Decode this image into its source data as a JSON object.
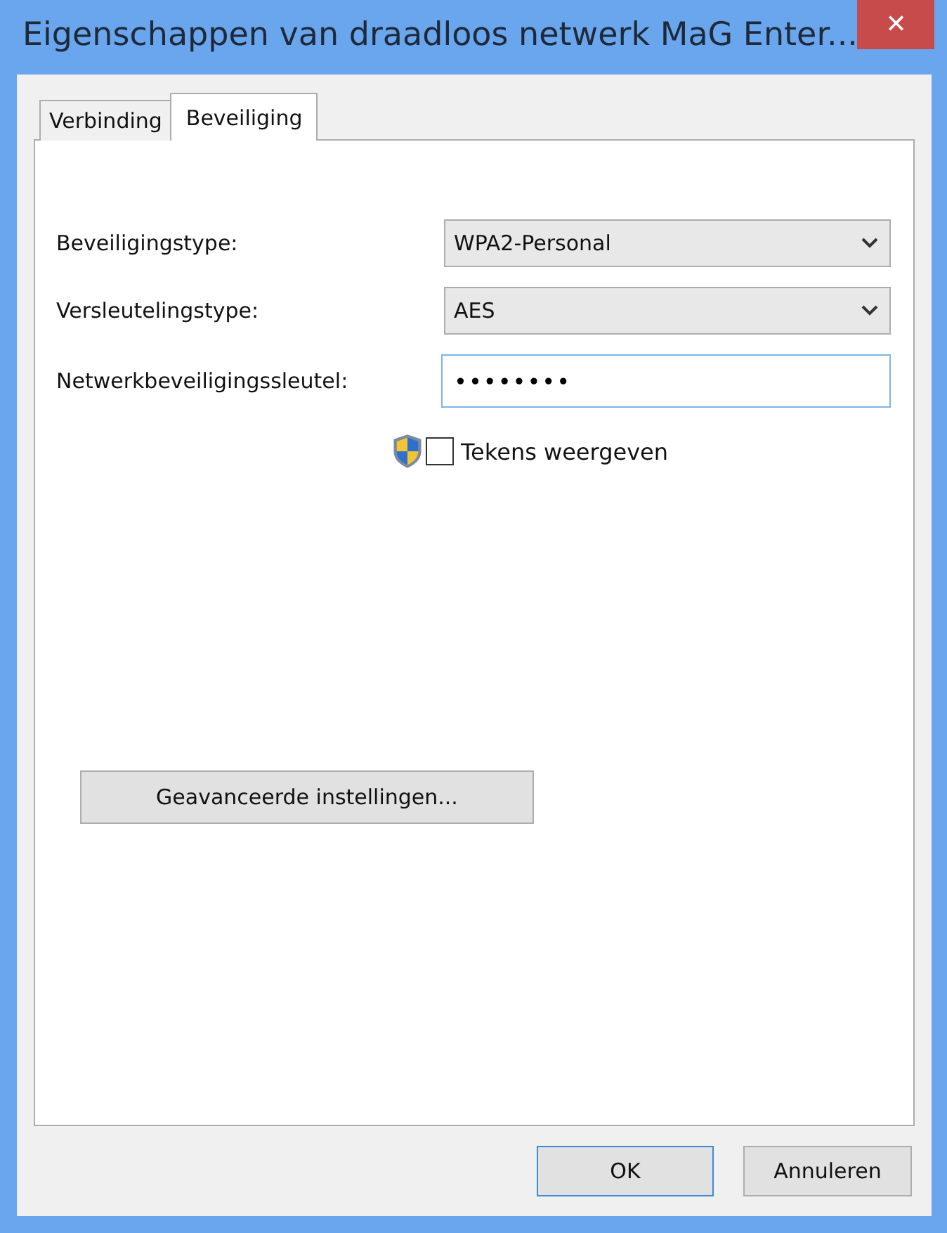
{
  "window": {
    "title": "Eigenschappen van draadloos netwerk MaG Enter...",
    "close": "✕"
  },
  "tabs": [
    {
      "label": "Verbinding",
      "selected": false
    },
    {
      "label": "Beveiliging",
      "selected": true
    }
  ],
  "fields": [
    {
      "kind": "dropdown",
      "label": "Beveiligingstype:",
      "value": "WPA2-Personal"
    },
    {
      "kind": "dropdown",
      "label": "Versleutelingstype:",
      "value": "AES"
    },
    {
      "kind": "text",
      "label": "Netwerkbeveiligingssleutel:",
      "value": "••••••••",
      "focused": true
    }
  ],
  "show_characters": {
    "label": "Tekens weergeven",
    "checked": false
  },
  "advanced_button": "Geavanceerde instellingen...",
  "buttons": [
    {
      "label": "OK",
      "default": true
    },
    {
      "label": "Annuleren",
      "default": false
    }
  ]
}
